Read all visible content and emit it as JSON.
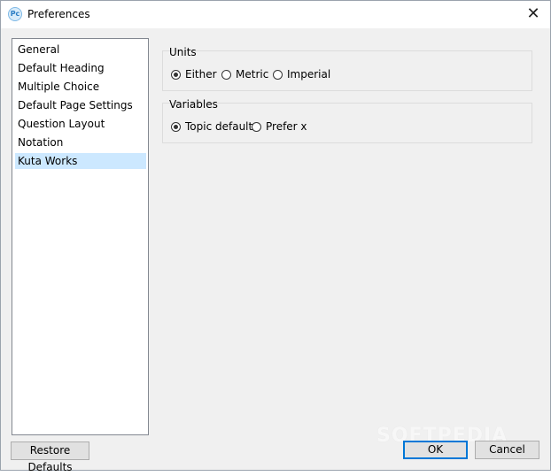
{
  "window": {
    "title": "Preferences",
    "app_icon_text": "Pc",
    "close_glyph": "✕"
  },
  "sidebar": {
    "items": [
      {
        "label": "General",
        "selected": false
      },
      {
        "label": "Default Heading",
        "selected": false
      },
      {
        "label": "Multiple Choice",
        "selected": false
      },
      {
        "label": "Default Page Settings",
        "selected": false
      },
      {
        "label": "Question Layout",
        "selected": false
      },
      {
        "label": "Notation",
        "selected": false
      },
      {
        "label": "Kuta Works",
        "selected": true
      }
    ]
  },
  "units": {
    "label": "Units",
    "options": [
      {
        "label": "Either",
        "checked": true
      },
      {
        "label": "Metric",
        "checked": false
      },
      {
        "label": "Imperial",
        "checked": false
      }
    ]
  },
  "variables": {
    "label": "Variables",
    "options": [
      {
        "label": "Topic default",
        "checked": true
      },
      {
        "label": "Prefer x",
        "checked": false
      }
    ]
  },
  "buttons": {
    "restore_defaults": "Restore Defaults",
    "ok": "OK",
    "cancel": "Cancel"
  },
  "watermark": "SOFTPEDIA",
  "colors": {
    "selection": "#cce8ff",
    "default_button_border": "#0078d7"
  }
}
